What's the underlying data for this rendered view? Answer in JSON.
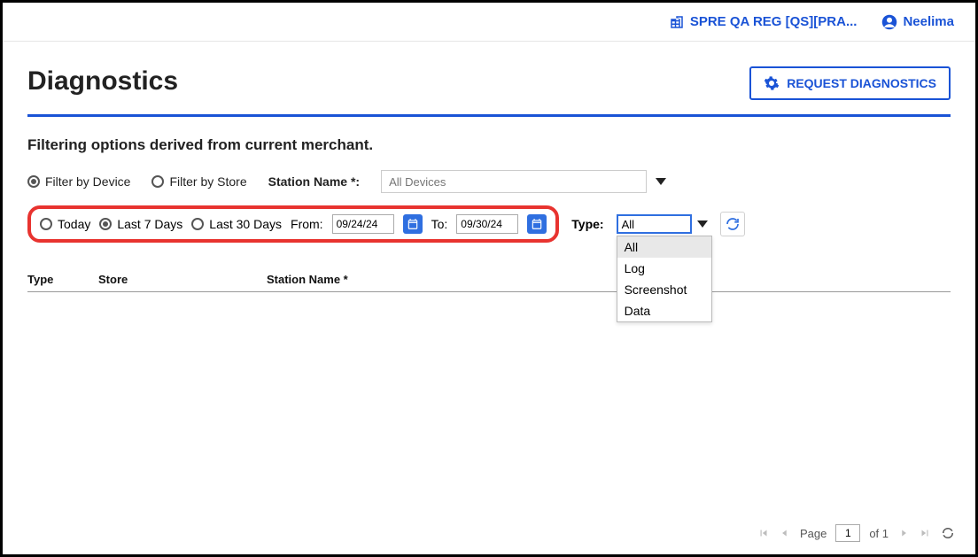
{
  "header": {
    "org_label": "SPRE QA REG [QS][PRA...",
    "user_name": "Neelima"
  },
  "page": {
    "title": "Diagnostics",
    "request_button": "REQUEST DIAGNOSTICS",
    "filter_heading": "Filtering options derived from current merchant."
  },
  "filter": {
    "by_device": "Filter by Device",
    "by_store": "Filter by Store",
    "station_label": "Station Name *:",
    "station_placeholder": "All Devices",
    "today": "Today",
    "last7": "Last 7 Days",
    "last30": "Last 30 Days",
    "from_label": "From:",
    "from_value": "09/24/24",
    "to_label": "To:",
    "to_value": "09/30/24",
    "type_label": "Type:",
    "type_value": "All",
    "type_options": [
      "All",
      "Log",
      "Screenshot",
      "Data"
    ]
  },
  "table": {
    "headers": {
      "type": "Type",
      "store": "Store",
      "station": "Station Name *"
    }
  },
  "pager": {
    "page_label": "Page",
    "page_value": "1",
    "of_label": "of 1"
  }
}
